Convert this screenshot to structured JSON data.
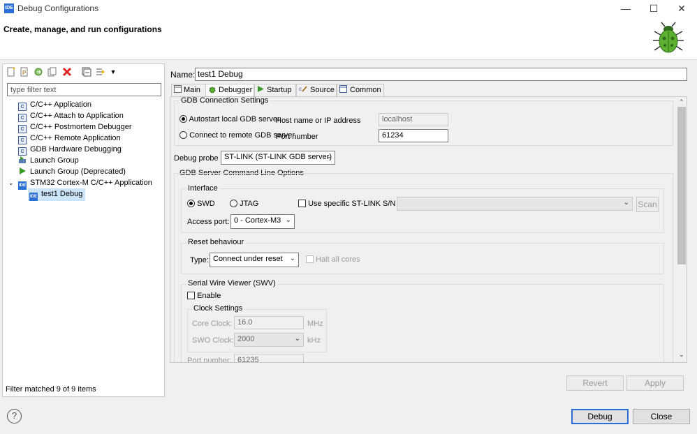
{
  "window": {
    "title": "Debug Configurations",
    "minimize": "—",
    "maximize": "☐",
    "close": "✕",
    "app_icon": "IDE"
  },
  "header": {
    "title": "Create, manage, and run configurations",
    "icon": "bug-icon"
  },
  "left": {
    "filter_placeholder": "type filter text",
    "toolbar_icons": [
      "new-configuration-icon",
      "new-prototype-icon",
      "export-icon",
      "duplicate-icon",
      "delete-icon",
      "collapse-all-icon",
      "filter-icon",
      "view-menu-icon"
    ],
    "tree": [
      {
        "label": "C/C++ Application",
        "icon": "c-icon"
      },
      {
        "label": "C/C++ Attach to Application",
        "icon": "c-icon"
      },
      {
        "label": "C/C++ Postmortem Debugger",
        "icon": "c-icon"
      },
      {
        "label": "C/C++ Remote Application",
        "icon": "c-icon"
      },
      {
        "label": "GDB Hardware Debugging",
        "icon": "c-icon"
      },
      {
        "label": "Launch Group",
        "icon": "launch-group-icon"
      },
      {
        "label": "Launch Group (Deprecated)",
        "icon": "launch-group-deprecated-icon"
      },
      {
        "label": "STM32 Cortex-M C/C++ Application",
        "icon": "ide-icon",
        "expanded": true
      },
      {
        "label": "test1 Debug",
        "icon": "ide-icon",
        "selected": true
      }
    ],
    "status": "Filter matched 9 of 9 items"
  },
  "right": {
    "name_label": "Name:",
    "name_value": "test1 Debug",
    "tabs": [
      "Main",
      "Debugger",
      "Startup",
      "Source",
      "Common"
    ],
    "active_tab": "Debugger",
    "gdb_group": "GDB Connection Settings",
    "autostart": "Autostart local GDB server",
    "connect_remote": "Connect to remote GDB server",
    "host_label": "Host name or IP address",
    "host_value": "localhost",
    "port_label": "Port number",
    "port_value": "61234",
    "probe_label": "Debug probe",
    "probe_value": "ST-LINK (ST-LINK GDB server)",
    "server_opts": "GDB Server Command Line Options",
    "interface_group": "Interface",
    "swd": "SWD",
    "jtag": "JTAG",
    "use_sn": "Use specific ST-LINK S/N",
    "sn_value": "",
    "scan": "Scan",
    "access_port_label": "Access port:",
    "access_port_value": "0 - Cortex-M3",
    "reset_group": "Reset behaviour",
    "type_label": "Type:",
    "type_value": "Connect under reset",
    "halt_all": "Halt all cores",
    "swv_group": "Serial Wire Viewer (SWV)",
    "enable": "Enable",
    "clock_group": "Clock Settings",
    "core_clock_label": "Core Clock:",
    "core_clock_value": "16.0",
    "core_clock_unit": "MHz",
    "swo_clock_label": "SWO Clock:",
    "swo_clock_value": "2000",
    "swo_clock_unit": "kHz",
    "swv_port_label": "Port number:",
    "swv_port_value": "61235",
    "revert": "Revert",
    "apply": "Apply"
  },
  "footer": {
    "help": "?",
    "debug": "Debug",
    "close": "Close"
  }
}
